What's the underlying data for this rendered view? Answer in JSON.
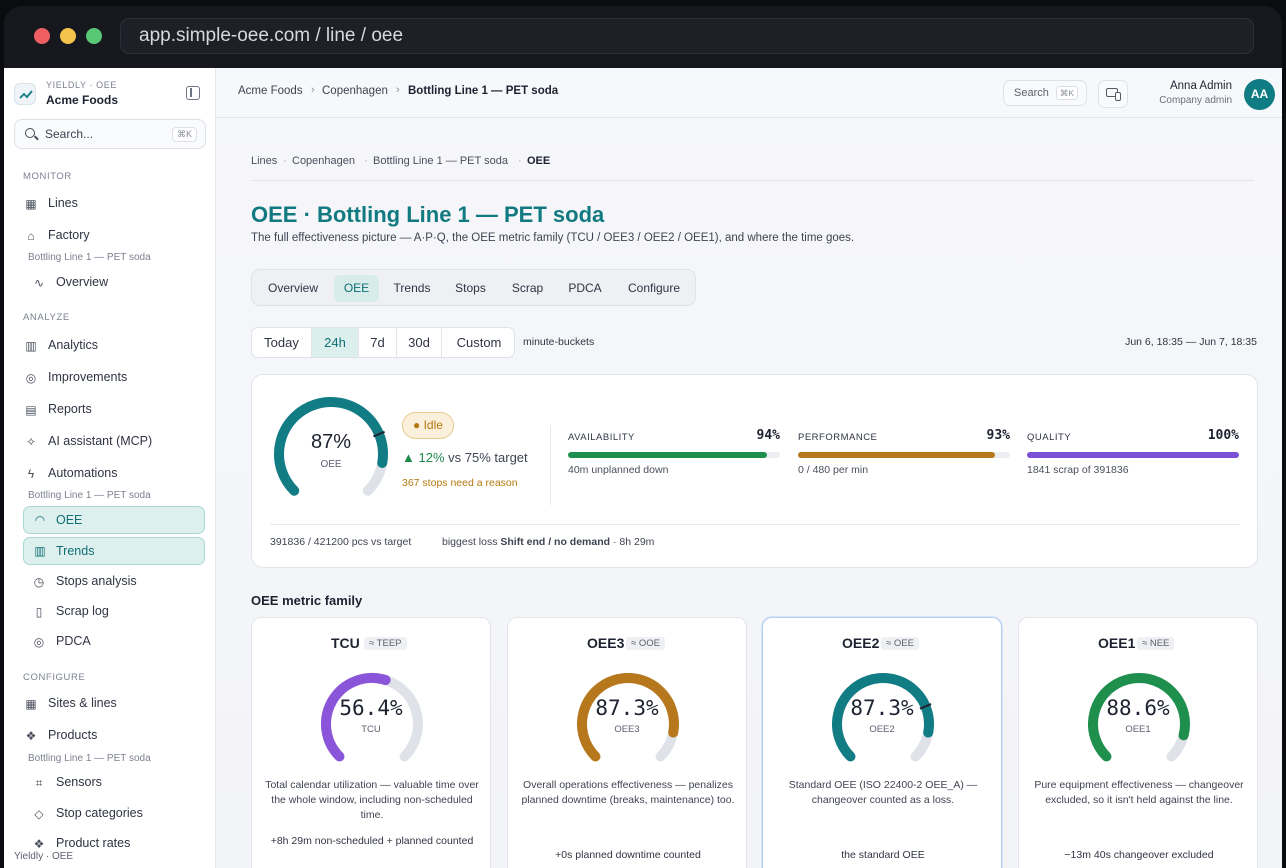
{
  "browser": {
    "url": "app.simple-oee.com / line / oee"
  },
  "sidebar": {
    "brand_sub": "YIELDLY · OEE",
    "brand_name": "Acme Foods",
    "search_placeholder": "Search...",
    "search_kbd": "⌘K",
    "sections": {
      "monitor": "MONITOR",
      "analyze": "ANALYZE",
      "configure": "CONFIGURE"
    },
    "line_caption": "Bottling Line 1 — PET soda",
    "items": {
      "lines": "Lines",
      "factory": "Factory",
      "overview": "Overview",
      "analytics": "Analytics",
      "improvements": "Improvements",
      "reports": "Reports",
      "ai": "AI assistant (MCP)",
      "automations": "Automations",
      "oee": "OEE",
      "trends": "Trends",
      "stops": "Stops analysis",
      "scrap": "Scrap log",
      "pdca": "PDCA",
      "sites": "Sites & lines",
      "products": "Products",
      "sensors": "Sensors",
      "stop_categories": "Stop categories",
      "product_rates": "Product rates"
    },
    "footer": "Yieldly · OEE"
  },
  "topbar": {
    "breadcrumb": [
      "Acme Foods",
      "Copenhagen",
      "Bottling Line 1 — PET soda"
    ],
    "search_label": "Search",
    "search_kbd": "⌘K",
    "user_name": "Anna Admin",
    "user_role": "Company admin",
    "avatar": "AA"
  },
  "page": {
    "breadcrumb": [
      "Lines",
      "Copenhagen",
      "Bottling Line 1 — PET soda",
      "OEE"
    ],
    "title": "OEE · Bottling Line 1 — PET soda",
    "subtitle": "The full effectiveness picture — A·P·Q, the OEE metric family (TCU / OEE3 / OEE2 / OEE1), and where the time goes.",
    "tabs": [
      "Overview",
      "OEE",
      "Trends",
      "Stops",
      "Scrap",
      "PDCA",
      "Configure"
    ],
    "active_tab": "OEE",
    "ranges": [
      "Today",
      "24h",
      "7d",
      "30d",
      "Custom"
    ],
    "active_range": "24h",
    "buckets": "minute-buckets",
    "date_range": "Jun 6, 18:35 — Jun 7, 18:35"
  },
  "summary": {
    "oee_value": "87%",
    "oee_label": "OEE",
    "oee_fraction": 0.87,
    "target_fraction": 0.75,
    "status": "Idle",
    "delta_arrow": "▲",
    "delta": "12%",
    "delta_suffix": "vs 75% target",
    "stops_note": "367 stops need a reason",
    "metrics": [
      {
        "label": "AVAILABILITY",
        "value": "94%",
        "fraction": 0.94,
        "note": "40m unplanned down",
        "color": "#1f8f4e"
      },
      {
        "label": "PERFORMANCE",
        "value": "93%",
        "fraction": 0.93,
        "note": "0 / 480 per min",
        "color": "#b7781d"
      },
      {
        "label": "QUALITY",
        "value": "100%",
        "fraction": 1.0,
        "note": "1841 scrap of 391836",
        "color": "#7b4fd6"
      }
    ],
    "pieces": "391836 / 421200 pcs vs target",
    "loss_prefix": "biggest loss",
    "loss_name": "Shift end / no demand",
    "loss_suffix": "· 8h 29m"
  },
  "family": {
    "title": "OEE metric family",
    "cards": [
      {
        "name": "TCU",
        "alias": "≈ TEEP",
        "value": "56.4%",
        "fraction": 0.564,
        "label": "TCU",
        "color": "#8a55d8",
        "desc": "Total calendar utilization — valuable time over the whole window, including non-scheduled time.",
        "extra": "+8h 29m non-scheduled + planned counted"
      },
      {
        "name": "OEE3",
        "alias": "≈ OOE",
        "value": "87.3%",
        "fraction": 0.873,
        "label": "OEE3",
        "color": "#b7781d",
        "desc": "Overall operations effectiveness — penalizes planned downtime (breaks, maintenance) too.",
        "extra": "+0s planned downtime counted"
      },
      {
        "name": "OEE2",
        "alias": "≈ OEE",
        "value": "87.3%",
        "fraction": 0.873,
        "label": "OEE2",
        "color": "#127c84",
        "desc": "Standard OEE (ISO 22400-2 OEE_A) — changeover counted as a loss.",
        "extra": "the standard OEE"
      },
      {
        "name": "OEE1",
        "alias": "≈ NEE",
        "value": "88.6%",
        "fraction": 0.886,
        "label": "OEE1",
        "color": "#1f8f4e",
        "desc": "Pure equipment effectiveness — changeover excluded, so it isn't held against the line.",
        "extra": "−13m 40s changeover excluded"
      }
    ]
  },
  "colors": {
    "accent": "#127c84",
    "oee_arc": "#127c84",
    "arc_track": "#dfe2e8"
  }
}
